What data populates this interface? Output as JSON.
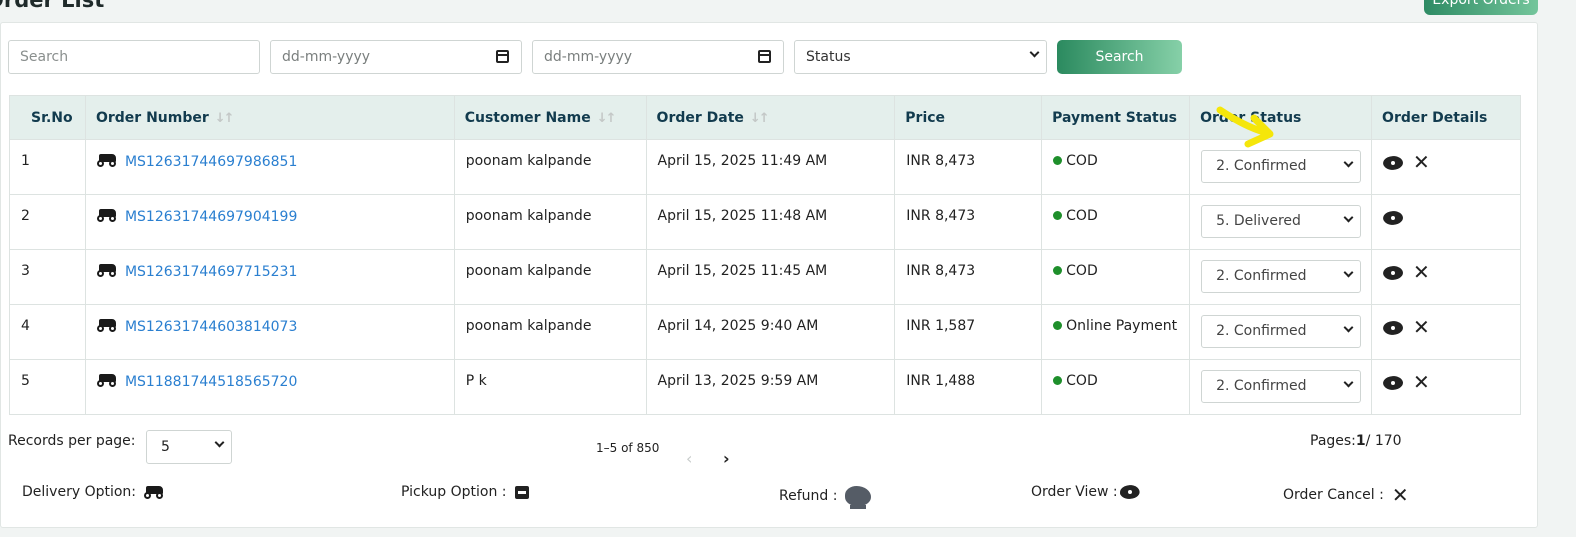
{
  "page": {
    "title": "Order List",
    "export_label": "Export Orders"
  },
  "filters": {
    "search_placeholder": "Search",
    "date_from_placeholder": "dd-mm-yyyy",
    "date_to_placeholder": "dd-mm-yyyy",
    "status_value": "Status",
    "search_button": "Search"
  },
  "table": {
    "headers": {
      "srno": "Sr.No",
      "order_number": "Order Number",
      "customer_name": "Customer Name",
      "order_date": "Order Date",
      "price": "Price",
      "payment_status": "Payment Status",
      "order_status": "Order Status",
      "order_details": "Order Details"
    },
    "sort_icon": "↓↑",
    "rows": [
      {
        "sr": "1",
        "order_number": "MS12631744697986851",
        "customer": "poonam kalpande",
        "date": "April 15, 2025 11:49 AM",
        "price": "INR 8,473",
        "payment": "COD",
        "status": "2. Confirmed",
        "cancel_visible": true
      },
      {
        "sr": "2",
        "order_number": "MS12631744697904199",
        "customer": "poonam kalpande",
        "date": "April 15, 2025 11:48 AM",
        "price": "INR 8,473",
        "payment": "COD",
        "status": "5. Delivered",
        "cancel_visible": false
      },
      {
        "sr": "3",
        "order_number": "MS12631744697715231",
        "customer": "poonam kalpande",
        "date": "April 15, 2025 11:45 AM",
        "price": "INR 8,473",
        "payment": "COD",
        "status": "2. Confirmed",
        "cancel_visible": true
      },
      {
        "sr": "4",
        "order_number": "MS12631744603814073",
        "customer": "poonam kalpande",
        "date": "April 14, 2025 9:40 AM",
        "price": "INR 1,587",
        "payment": "Online Payment",
        "status": "2. Confirmed",
        "cancel_visible": true
      },
      {
        "sr": "5",
        "order_number": "MS11881744518565720",
        "customer": "P k",
        "date": "April 13, 2025 9:59 AM",
        "price": "INR 1,488",
        "payment": "COD",
        "status": "2. Confirmed",
        "cancel_visible": true
      }
    ]
  },
  "pagination": {
    "records_label": "Records per page:",
    "records_value": "5",
    "range": "1–5 of 850",
    "pages_label": "Pages:",
    "current_page": "1",
    "total_pages": "/ 170"
  },
  "legend": {
    "delivery": "Delivery Option:",
    "pickup": "Pickup Option :",
    "refund": "Refund :",
    "view": "Order View :",
    "cancel": "Order Cancel :"
  },
  "colors": {
    "accent": "#2b8a5f",
    "link": "#2a7fd0",
    "payment_dot": "#1e8f2b",
    "header_bg": "#e4efec",
    "highlight": "#f5e60a"
  }
}
